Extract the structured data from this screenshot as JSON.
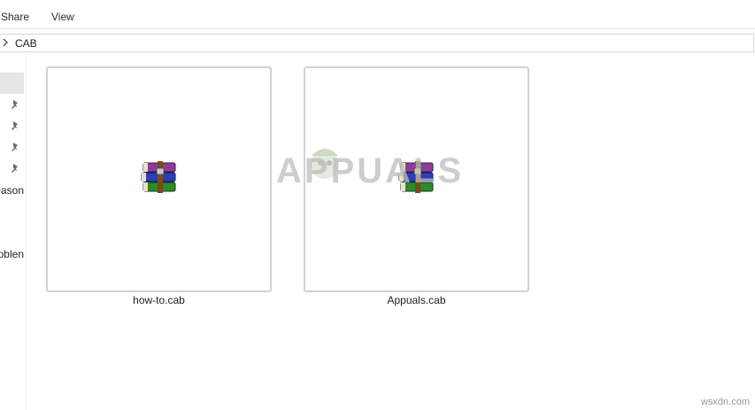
{
  "ribbon": {
    "tabs": [
      {
        "label": "Share"
      },
      {
        "label": "View"
      }
    ]
  },
  "address": {
    "crumb": "CAB"
  },
  "nav": {
    "labels": [
      "eason",
      "roblen"
    ]
  },
  "files": [
    {
      "name": "how-to.cab",
      "icon": "winrar-archive-icon"
    },
    {
      "name": "Appuals.cab",
      "icon": "winrar-archive-icon"
    }
  ],
  "watermark": {
    "brand": "APPUALS",
    "site": "wsxdn.com"
  },
  "colors": {
    "tile_border": "#d2d2d2",
    "nav_selected": "#e5e5e5",
    "archive_purple": "#8e3c9a",
    "archive_blue": "#2c3fb1",
    "archive_green": "#2d8a2d"
  }
}
